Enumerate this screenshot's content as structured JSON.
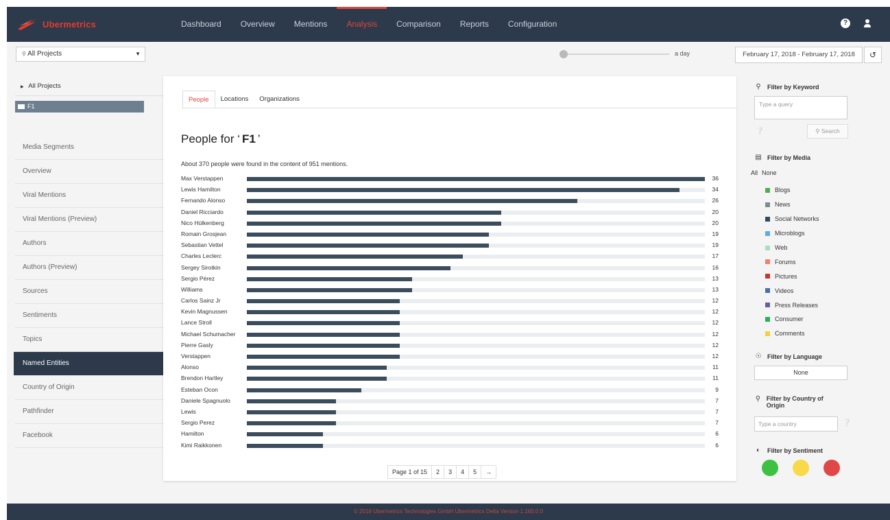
{
  "app": {
    "logo_text": "Ubermetrics"
  },
  "nav": {
    "items": [
      "Dashboard",
      "Overview",
      "Mentions",
      "Analysis",
      "Comparison",
      "Reports",
      "Configuration"
    ],
    "active": "Analysis"
  },
  "toolbar": {
    "project_select": "All Projects",
    "slider_label": "a day",
    "date_range": "February 17, 2018 - February 17, 2018"
  },
  "sidebar": {
    "tree_root": "All Projects",
    "tree_selected": "F1",
    "items": [
      "Media Segments",
      "Overview",
      "Viral Mentions",
      "Viral Mentions (Preview)",
      "Authors",
      "Authors (Preview)",
      "Sources",
      "Sentiments",
      "Topics",
      "Named Entities",
      "Country of Origin",
      "Pathfinder",
      "Facebook"
    ],
    "active": "Named Entities"
  },
  "main": {
    "tabs": [
      "People",
      "Locations",
      "Organizations"
    ],
    "active_tab": "People",
    "title_prefix": "People for ‘",
    "title_query": "F1",
    "title_suffix": "’",
    "summary": "About 370 people were found in the content of 951 mentions.",
    "pagination": {
      "current": "Page 1 of 15",
      "pages": [
        "2",
        "3",
        "4",
        "5"
      ],
      "next": "→"
    }
  },
  "chart_data": {
    "type": "bar",
    "orientation": "horizontal",
    "categories": [
      "Max Verstappen",
      "Lewis Hamilton",
      "Fernando Alonso",
      "Daniel Ricciardo",
      "Nico Hülkenberg",
      "Romain Grosjean",
      "Sebastian Vettel",
      "Charles Leclerc",
      "Sergey Sirotkin",
      "Sergio Pérez",
      "Williams",
      "Carlos Sainz Jr",
      "Kevin Magnussen",
      "Lance Stroll",
      "Michael Schumacher",
      "Pierre Gasly",
      "Verstappen",
      "Alonso",
      "Brendon Hartley",
      "Esteban Ocon",
      "Daniele Spagnuolo",
      "Lewis",
      "Sergio Perez",
      "Hamilton",
      "Kimi Raikkonen"
    ],
    "values": [
      36,
      34,
      26,
      20,
      20,
      19,
      19,
      17,
      16,
      13,
      13,
      12,
      12,
      12,
      12,
      12,
      12,
      11,
      11,
      9,
      7,
      7,
      7,
      6,
      6
    ],
    "xlim": [
      0,
      36
    ],
    "color": "#3b4d5c"
  },
  "right": {
    "keyword": {
      "heading": "Filter by Keyword",
      "placeholder": "Type a query",
      "search_label": "Search"
    },
    "media": {
      "heading": "Filter by Media",
      "all_label": "All",
      "none_label": "None",
      "items": [
        {
          "label": "Blogs",
          "color": "#4caf50"
        },
        {
          "label": "News",
          "color": "#7f8c8d"
        },
        {
          "label": "Social Networks",
          "color": "#34495e"
        },
        {
          "label": "Microblogs",
          "color": "#5dade2"
        },
        {
          "label": "Web",
          "color": "#a9dfbf"
        },
        {
          "label": "Forums",
          "color": "#f0826a"
        },
        {
          "label": "Pictures",
          "color": "#c0392b"
        },
        {
          "label": "Videos",
          "color": "#4a6fa5"
        },
        {
          "label": "Press Releases",
          "color": "#6c5b9e"
        },
        {
          "label": "Consumer",
          "color": "#27ae60"
        },
        {
          "label": "Comments",
          "color": "#f4d03f"
        }
      ]
    },
    "language": {
      "heading": "Filter by Language",
      "value": "None"
    },
    "country": {
      "heading": "Filter by Country of Origin",
      "placeholder": "Type a country"
    },
    "sentiment": {
      "heading": "Filter by Sentiment",
      "colors": {
        "positive": "#3ec142",
        "neutral": "#f8d94a",
        "negative": "#e04848"
      }
    }
  },
  "footer": {
    "text": "© 2018 Ubermetrics Technologies GmbH Ubermetrics Delta Version 1.160.0.0"
  }
}
